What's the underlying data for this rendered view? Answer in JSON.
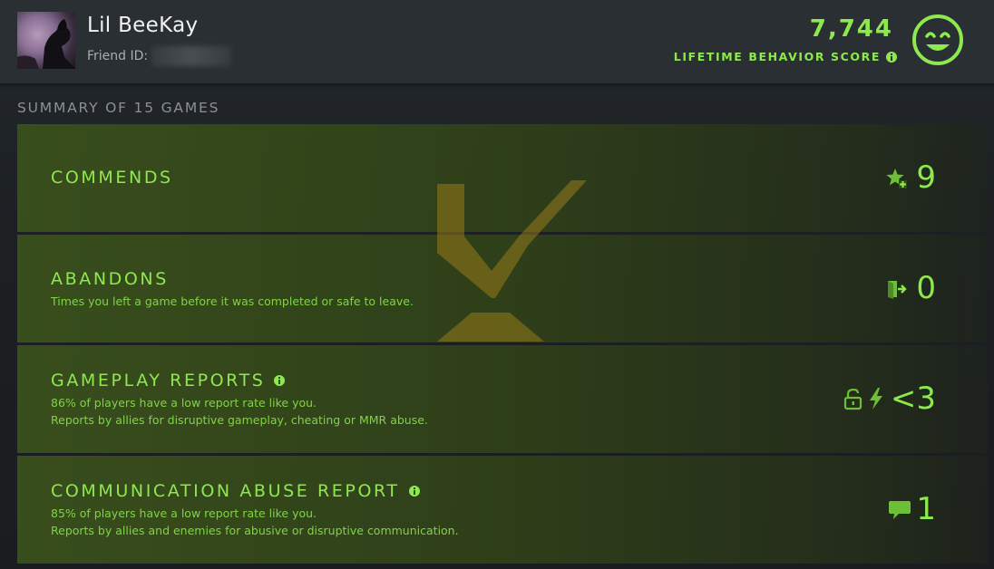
{
  "player": {
    "name": "Lil BeeKay",
    "friend_id_label": "Friend ID:"
  },
  "behavior": {
    "score": "7,744",
    "label": "LIFETIME BEHAVIOR SCORE"
  },
  "summary": {
    "title": "SUMMARY OF 15 GAMES"
  },
  "panels": [
    {
      "title": "COMMENDS",
      "value": "9",
      "icon": "star-plus-icon",
      "lines": []
    },
    {
      "title": "ABANDONS",
      "value": "0",
      "icon": "exit-door-icon",
      "lines": [
        "Times you left a game before it was completed or safe to leave."
      ]
    },
    {
      "title": "GAMEPLAY REPORTS",
      "value": "<3",
      "icon": "lock-lightning-icon",
      "lines": [
        "86% of players have a low report rate like you.",
        "Reports by allies for disruptive gameplay, cheating or MMR abuse."
      ]
    },
    {
      "title": "COMMUNICATION ABUSE REPORT",
      "value": "1",
      "icon": "chat-bubble-icon",
      "lines": [
        "85% of players have a low report rate like you.",
        "Reports by allies and enemies for abusive or disruptive communication."
      ]
    }
  ],
  "colors": {
    "accent_green": "#8ee94e",
    "watermark_gold": "#b08a1a",
    "header_bg": "#2a2f33"
  }
}
